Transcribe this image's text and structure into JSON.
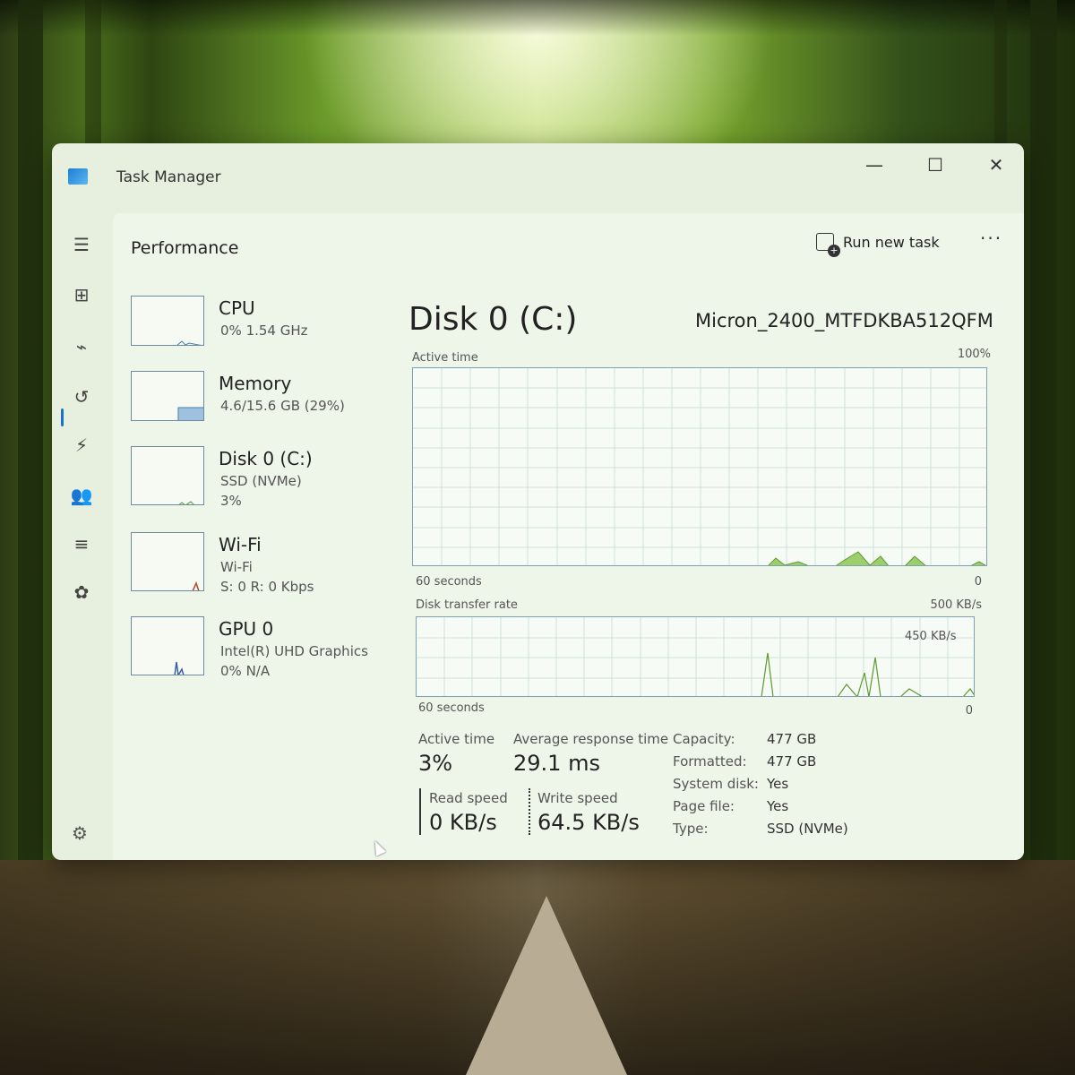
{
  "window": {
    "title": "Task Manager",
    "minimize_glyph": "—",
    "maximize_glyph": "☐",
    "close_glyph": "✕"
  },
  "nav": {
    "items": [
      {
        "icon": "hamburger-menu-icon",
        "glyph": "☰"
      },
      {
        "icon": "processes-icon",
        "glyph": "⊞"
      },
      {
        "icon": "performance-icon",
        "glyph": "⌁",
        "active": true
      },
      {
        "icon": "app-history-icon",
        "glyph": "↺"
      },
      {
        "icon": "startup-apps-icon",
        "glyph": "⚡"
      },
      {
        "icon": "users-icon",
        "glyph": "👥"
      },
      {
        "icon": "details-icon",
        "glyph": "≡"
      },
      {
        "icon": "services-icon",
        "glyph": "✿"
      }
    ],
    "settings_glyph": "⚙"
  },
  "header": {
    "page_title": "Performance",
    "run_new_task_label": "Run new task",
    "more_glyph": "···"
  },
  "resources": [
    {
      "name": "CPU",
      "line1": "0%  1.54 GHz",
      "line2": ""
    },
    {
      "name": "Memory",
      "line1": "4.6/15.6 GB (29%)",
      "line2": ""
    },
    {
      "name": "Disk 0 (C:)",
      "line1": "SSD (NVMe)",
      "line2": "3%"
    },
    {
      "name": "Wi-Fi",
      "line1": "Wi-Fi",
      "line2": "S: 0  R: 0 Kbps"
    },
    {
      "name": "GPU 0",
      "line1": "Intel(R) UHD Graphics",
      "line2": "0%  N/A"
    }
  ],
  "detail": {
    "title": "Disk 0 (C:)",
    "model": "Micron_2400_MTFDKBA512QFM",
    "active_time_graph": {
      "label": "Active time",
      "max_label": "100%",
      "left_footer": "60 seconds",
      "right_footer": "0",
      "activity_percent": 3
    },
    "transfer_graph": {
      "label": "Disk transfer rate",
      "max_label": "500 KB/s",
      "inner_label": "450 KB/s",
      "left_footer": "60 seconds",
      "right_footer": "0"
    },
    "stats": {
      "active_time_label": "Active time",
      "active_time_value": "3%",
      "avg_response_label": "Average response time",
      "avg_response_value": "29.1 ms",
      "read_speed_label": "Read speed",
      "read_speed_value": "0 KB/s",
      "write_speed_label": "Write speed",
      "write_speed_value": "64.5 KB/s"
    },
    "properties": [
      {
        "label": "Capacity:",
        "value": "477 GB"
      },
      {
        "label": "Formatted:",
        "value": "477 GB"
      },
      {
        "label": "System disk:",
        "value": "Yes"
      },
      {
        "label": "Page file:",
        "value": "Yes"
      },
      {
        "label": "Type:",
        "value": "SSD (NVMe)"
      }
    ]
  },
  "colors": {
    "disk_graph_fill": "#9ccf6b",
    "disk_graph_line": "#5c9a2e",
    "graph_grid": "#cfe0d8",
    "accent": "#1a73c8"
  }
}
